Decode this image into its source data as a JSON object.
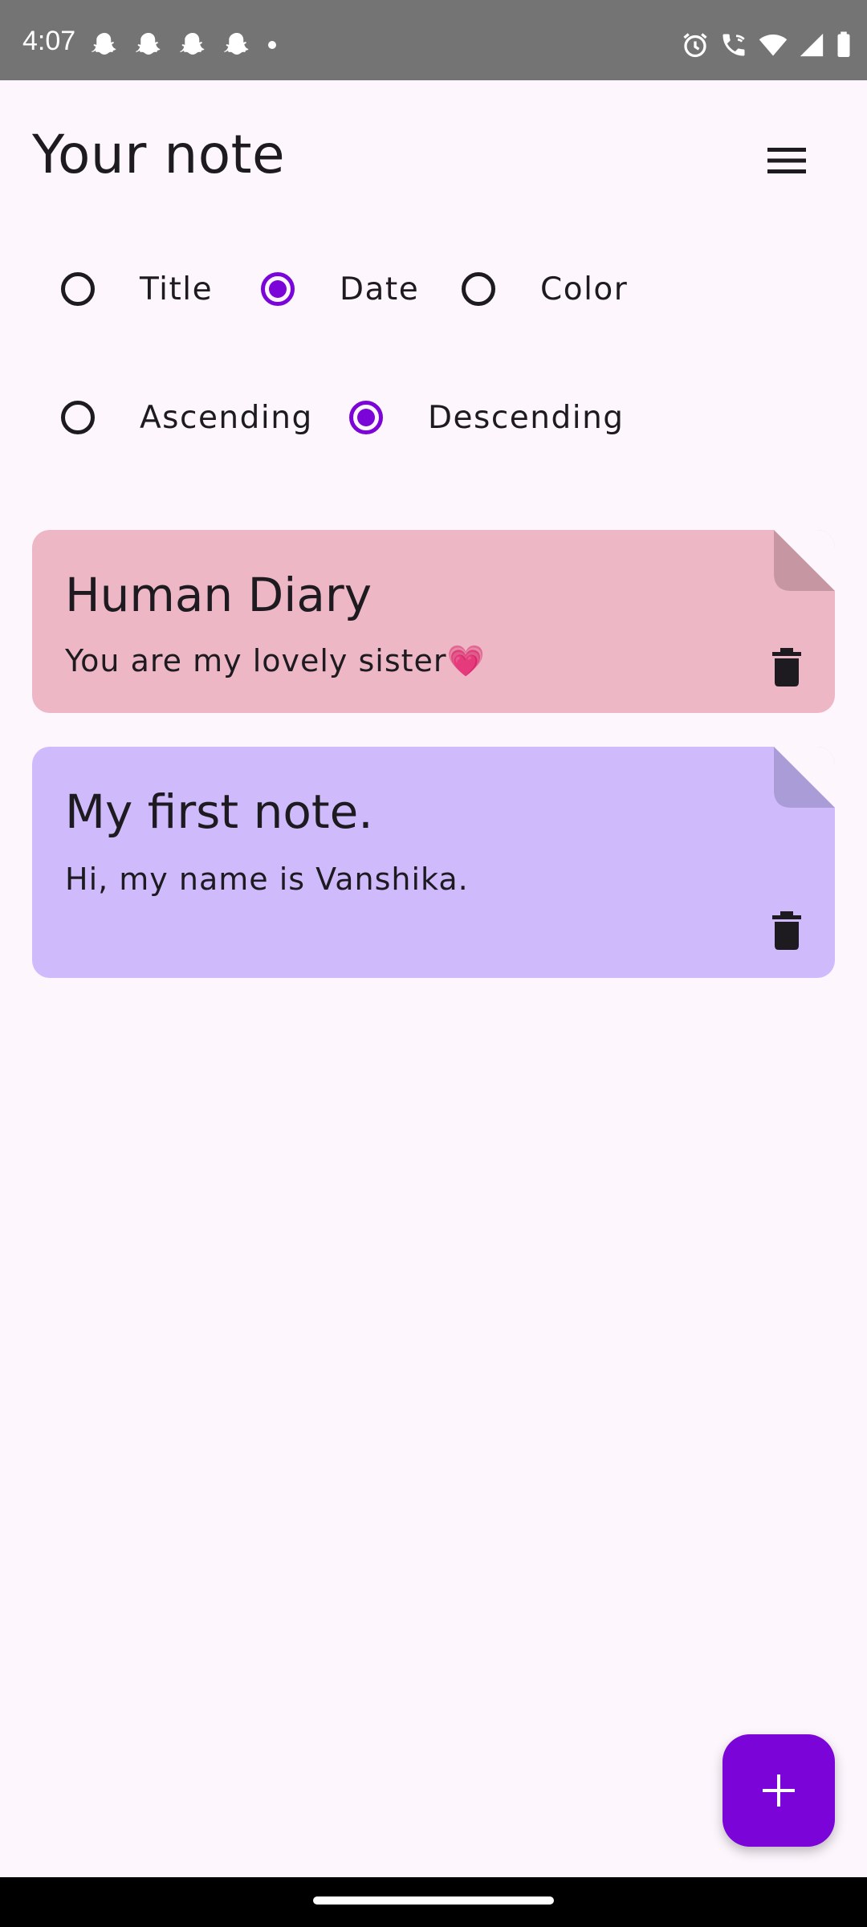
{
  "status_bar": {
    "time": "4:07",
    "left_icons": [
      "snapchat-icon",
      "snapchat-icon",
      "snapchat-icon",
      "snapchat-icon",
      "dot-icon"
    ],
    "right_icons": [
      "alarm-icon",
      "wifi-calling-icon",
      "wifi-icon",
      "signal-icon",
      "battery-icon"
    ]
  },
  "header": {
    "title": "Your note",
    "menu_icon": "menu-icon"
  },
  "sort_by": {
    "options": [
      {
        "label": "Title",
        "checked": false
      },
      {
        "label": "Date",
        "checked": true
      },
      {
        "label": "Color",
        "checked": false
      }
    ]
  },
  "sort_order": {
    "options": [
      {
        "label": "Ascending",
        "checked": false
      },
      {
        "label": "Descending",
        "checked": true
      }
    ]
  },
  "notes": [
    {
      "title": "Human Diary",
      "body": "You are my lovely sister💗",
      "color": "#edb7c5",
      "fold_color": "#c696a3"
    },
    {
      "title": "My first note.",
      "body": "Hi, my name is Vanshika.",
      "color": "#cfbbfc",
      "fold_color": "#aa9cd7"
    }
  ],
  "fab": {
    "icon": "plus-icon"
  },
  "colors": {
    "accent": "#7b05d8",
    "background": "#fdf6fd"
  }
}
